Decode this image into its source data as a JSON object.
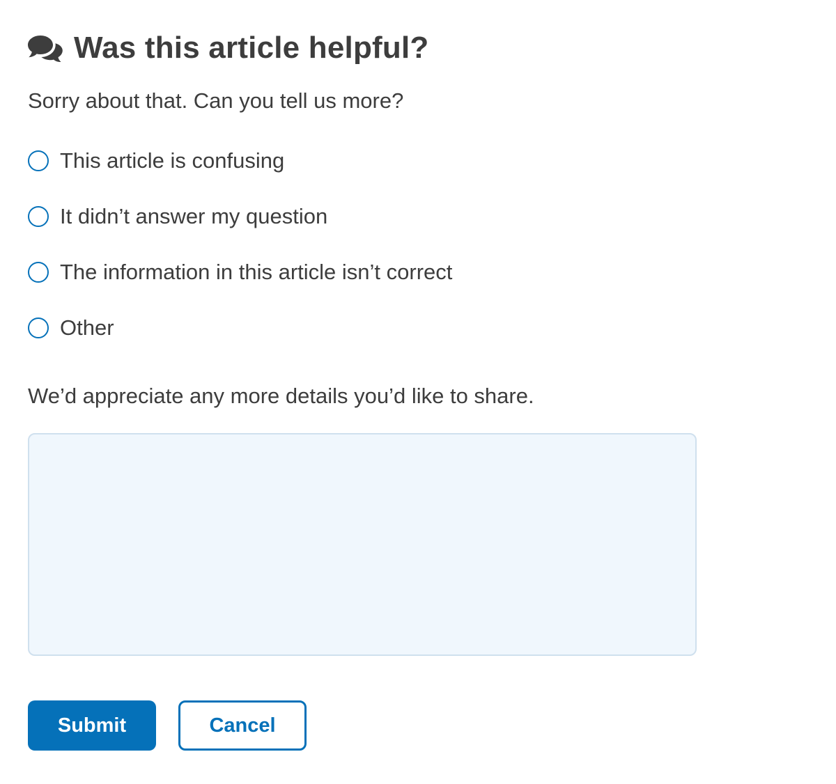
{
  "feedback": {
    "heading": "Was this article helpful?",
    "heading_icon": "comments-icon",
    "prompt": "Sorry about that. Can you tell us more?",
    "options": [
      {
        "label": "This article is confusing",
        "selected": false
      },
      {
        "label": "It didn’t answer my question",
        "selected": false
      },
      {
        "label": "The information in this article isn’t correct",
        "selected": false
      },
      {
        "label": "Other",
        "selected": false
      }
    ],
    "details_label": "We’d appreciate any more details you’d like to share.",
    "details_value": "",
    "submit_label": "Submit",
    "cancel_label": "Cancel"
  },
  "colors": {
    "accent": "#0571b9",
    "text": "#3d3d3d",
    "input_background": "#f0f7fd",
    "input_border": "#cfe0ee"
  }
}
